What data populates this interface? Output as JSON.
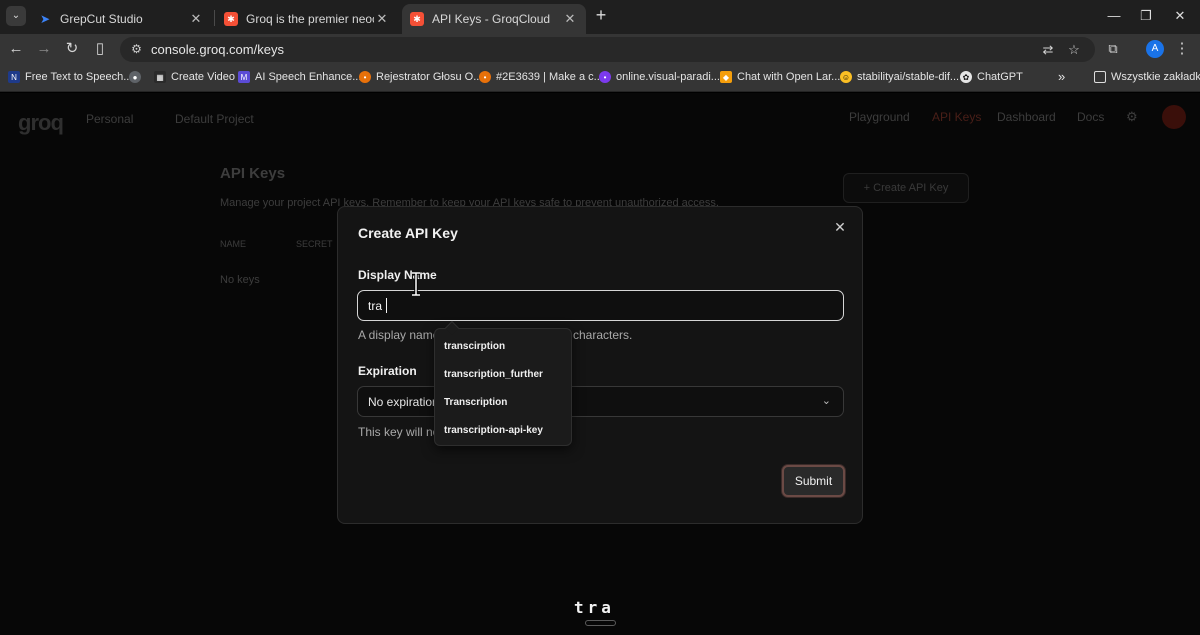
{
  "browser": {
    "tabs": [
      {
        "title": "GrepCut Studio",
        "icon": "grepcut-icon",
        "color": "#3b82f6"
      },
      {
        "title": "Groq is the premier neocloud fo",
        "icon": "groq-icon",
        "color": "#f55036"
      },
      {
        "title": "API Keys - GroqCloud",
        "icon": "groq-icon",
        "color": "#f55036",
        "active": true
      }
    ],
    "new_tab": "+",
    "url": "console.groq.com/keys",
    "profile_initial": "A",
    "bookmarks": [
      {
        "label": "Free Text to Speech...",
        "icon": "speechify-icon",
        "color": "#1e3a8a"
      },
      {
        "label": "",
        "icon": "globe-icon",
        "color": "#5f6368"
      },
      {
        "label": "Create Video",
        "icon": "video-icon",
        "color": "#3a3a3a"
      },
      {
        "label": "AI Speech Enhance...",
        "icon": "enhance-icon",
        "color": "#5b4bd6"
      },
      {
        "label": "Rejestrator Głosu O...",
        "icon": "recorder-icon",
        "color": "#e8710a"
      },
      {
        "label": "#2E3639 | Make a c...",
        "icon": "palette-icon",
        "color": "#e8710a"
      },
      {
        "label": "online.visual-paradi...",
        "icon": "paradigm-icon",
        "color": "#7c3aed"
      },
      {
        "label": "Chat with Open Lar...",
        "icon": "chat-icon",
        "color": "#f59e0b"
      },
      {
        "label": "stabilityai/stable-dif...",
        "icon": "huggingface-icon",
        "color": "#fbbf24"
      },
      {
        "label": "ChatGPT",
        "icon": "chatgpt-icon",
        "color": "#e5e5e5"
      }
    ],
    "bookmarks_overflow": "»",
    "all_bookmarks": "Wszystkie zakładki"
  },
  "page": {
    "project_label": "Personal",
    "project_select": "Default Project",
    "nav": [
      "Playground",
      "API Keys",
      "Dashboard",
      "Docs"
    ],
    "title": "API Keys",
    "description": "Manage your project API keys. Remember to keep your API keys safe to prevent unauthorized access.",
    "create_button": "+ Create API Key",
    "col_name": "NAME",
    "col_secret": "SECRET",
    "empty": "No keys"
  },
  "modal": {
    "title": "Create API Key",
    "display_name_label": "Display Name",
    "display_name_value": "tra",
    "display_name_help": "A display name",
    "display_name_help_tail": "characters.",
    "expiration_label": "Expiration",
    "expiration_value": "No expiration",
    "expiration_help": "This key will no",
    "submit": "Submit"
  },
  "autocomplete": [
    "transcirption",
    "transcription_further",
    "Transcription",
    "transcription-api-key"
  ],
  "caption": "tra"
}
